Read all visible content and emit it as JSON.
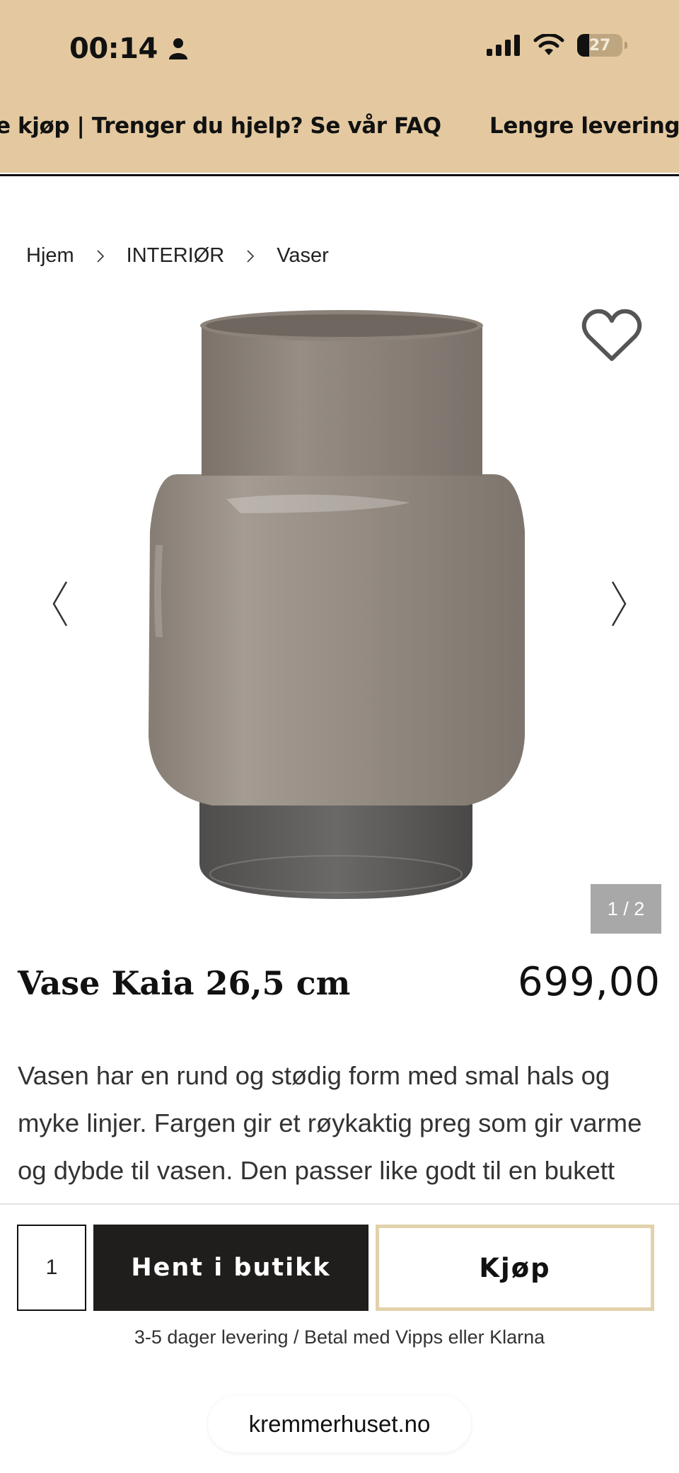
{
  "status_bar": {
    "time": "00:14",
    "battery_percent": "27",
    "battery_level": 0.27,
    "icons": [
      "person-icon",
      "signal-icon",
      "wifi-icon",
      "battery-icon"
    ]
  },
  "ticker": {
    "item_1": "e kjøp | Trenger du hjelp? Se vår FAQ",
    "item_2": "Lengre leverings"
  },
  "breadcrumb": {
    "home": "Hjem",
    "category": "INTERIØR",
    "subcategory": "Vaser"
  },
  "gallery": {
    "counter": "1 / 2",
    "current_index": 1,
    "total": 2
  },
  "product": {
    "title": "Vase Kaia 26,5 cm",
    "price": "699,00",
    "description": "Vasen har en rund og stødig form med smal hals og myke linjer. Fargen gir et røykaktig preg som gir varme og dybde til vasen. Den passer like godt til en bukett"
  },
  "buy_bar": {
    "quantity": "1",
    "pickup_label": "Hent i butikk",
    "buy_label": "Kjøp",
    "delivery_note": "3-5 dager levering / Betal med Vipps eller Klarna"
  },
  "browser": {
    "url": "kremmerhuset.no"
  },
  "colors": {
    "banner": "#e4c9a0",
    "button_dark": "#1f1e1c",
    "button_border": "#e2d2ab",
    "counter_bg": "#a8a8a8"
  }
}
